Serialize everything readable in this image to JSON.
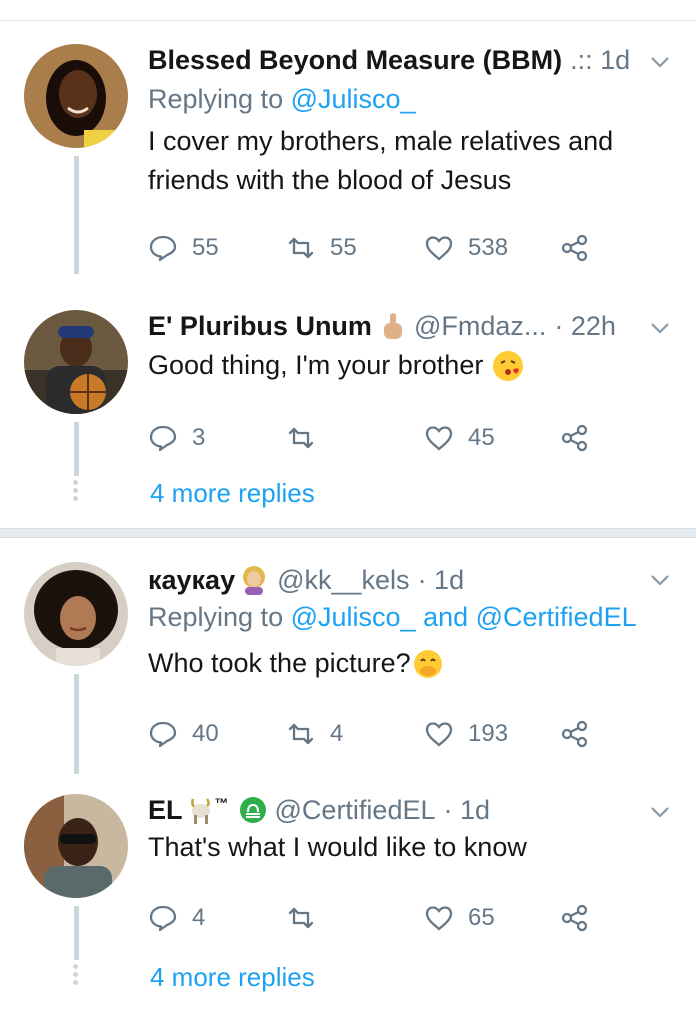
{
  "thread1": {
    "tweet1": {
      "name": "Blessed Beyond Measure (BBM)",
      "meta": ".:: 1d",
      "reply_prefix": "Replying to ",
      "reply_handle": "@Julisco_",
      "text": "I cover my brothers, male relatives and friends with the blood of Jesus",
      "replies": "55",
      "retweets": "55",
      "likes": "538"
    },
    "tweet2": {
      "name": "E' Pluribus Unum",
      "handle": "@Fmdaz...",
      "time": "· 22h",
      "text": "Good thing, I'm your brother",
      "replies": "3",
      "retweets": "",
      "likes": "45"
    },
    "more_replies": "4 more replies"
  },
  "thread2": {
    "tweet1": {
      "name": "кaукay",
      "handle": "@kk__kels",
      "time": "· 1d",
      "reply_prefix": "Replying to ",
      "reply_handle1": "@Julisco_",
      "reply_and": " and ",
      "reply_handle2": "@CertifiedEL",
      "text": "Who took the picture?",
      "replies": "40",
      "retweets": "4",
      "likes": "193"
    },
    "tweet2": {
      "name": "EL",
      "tm": "™",
      "handle": "@CertifiedEL",
      "time": "· 1d",
      "text": "That's what I would like to know",
      "replies": "4",
      "retweets": "",
      "likes": "65"
    },
    "more_replies": "4 more replies"
  },
  "colors": {
    "link": "#1da1f2",
    "secondary": "#657786",
    "divider": "#e1e8ed"
  }
}
